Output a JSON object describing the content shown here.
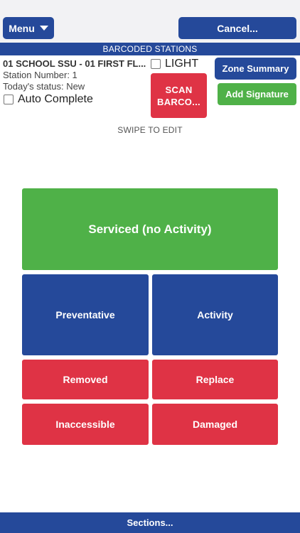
{
  "header": {
    "menu_label": "Menu",
    "cancel_label": "Cancel..."
  },
  "section_title": "BARCODED STATIONS",
  "station": {
    "name": "01 SCHOOL SSU - 01 FIRST FL...",
    "number_line": "Station Number: 1",
    "status_line": "Today's status: New",
    "light_label": "LIGHT",
    "light_checked": false,
    "auto_complete_label": "Auto Complete",
    "auto_complete_checked": false
  },
  "actions": {
    "scan_label": "SCAN BARCO...",
    "zone_summary_label": "Zone Summary",
    "add_signature_label": "Add Signature"
  },
  "hint": "SWIPE TO EDIT",
  "tiles": {
    "serviced": "Serviced (no Activity)",
    "preventative": "Preventative",
    "activity": "Activity",
    "removed": "Removed",
    "replace": "Replace",
    "inaccessible": "Inaccessible",
    "damaged": "Damaged"
  },
  "footer": {
    "sections_label": "Sections..."
  },
  "colors": {
    "primary_blue": "#25499a",
    "success_green": "#4fb148",
    "danger_red": "#df3345"
  },
  "icons": [
    "caret-down-icon"
  ]
}
